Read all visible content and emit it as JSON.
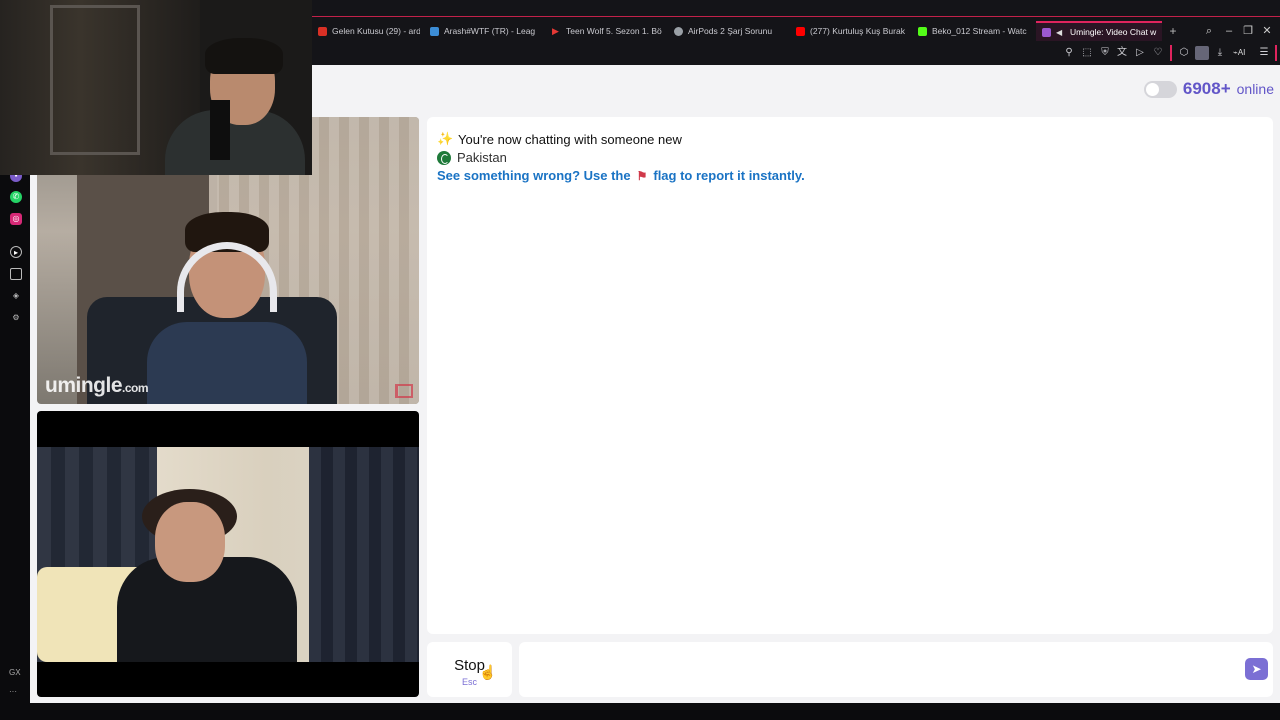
{
  "browser": {
    "tabs": [
      {
        "title": "Gelen Kutusu (29) - ard",
        "color": "#d93025"
      },
      {
        "title": "Arash#WTF (TR) - Leag",
        "color": "#3c8dd6"
      },
      {
        "title": "Teen Wolf 5. Sezon 1. Bö",
        "color": "#e53935"
      },
      {
        "title": "AirPods 2 Şarj Sorunu",
        "color": "#9aa0a6"
      },
      {
        "title": "(277) Kurtuluş Kuş Burak",
        "color": "#ff0000"
      },
      {
        "title": "Beko_012 Stream - Watc",
        "color": "#53fc18"
      },
      {
        "title": "Umingle: Video Chat w",
        "color": "#9b59d0"
      }
    ],
    "sidebar_label": "GX"
  },
  "header": {
    "online_count": "6908+",
    "online_label": "online"
  },
  "remote_video": {
    "watermark_brand": "umingle",
    "watermark_tld": ".com"
  },
  "chat": {
    "system_message": "You're now chatting with someone new",
    "country": "Pakistan",
    "report_prefix": "See something wrong? Use the",
    "report_suffix": "flag to report it instantly."
  },
  "controls": {
    "stop_label": "Stop",
    "stop_key": "Esc",
    "message_placeholder": ""
  },
  "colors": {
    "accent": "#6256c8",
    "link": "#1a73c4",
    "report_flag": "#d0394a"
  }
}
